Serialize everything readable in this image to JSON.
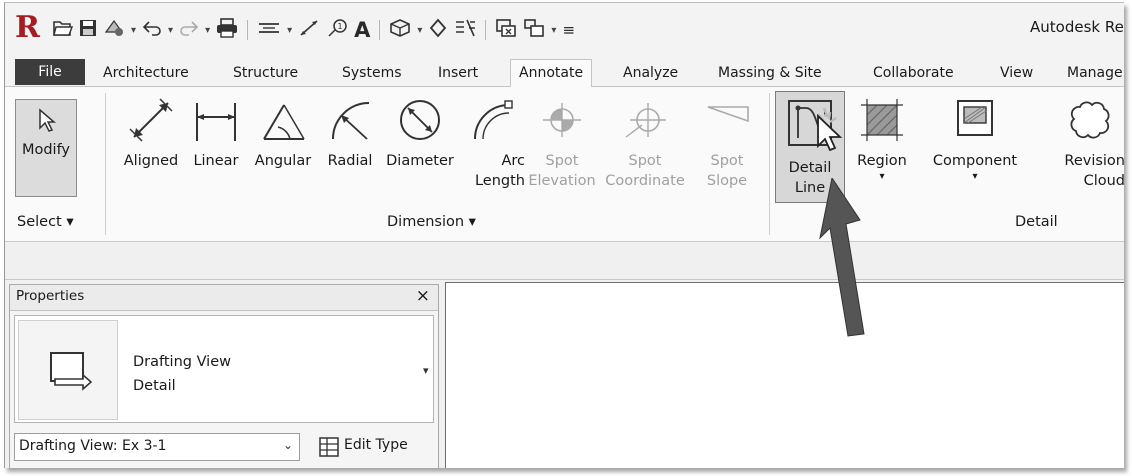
{
  "app": {
    "logo_letter": "R",
    "title": "Autodesk Re"
  },
  "quick_access": {
    "icons": [
      "open-icon",
      "save-icon",
      "sync-icon",
      "undo-icon",
      "redo-icon",
      "print-icon",
      "measure-icon",
      "dimension-icon",
      "tag-icon",
      "text-icon",
      "3d-view-icon",
      "section-icon",
      "thin-lines-icon",
      "close-hidden-icon",
      "switch-windows-icon",
      "customize-icon"
    ]
  },
  "tabs": [
    {
      "label": "File"
    },
    {
      "label": "Architecture"
    },
    {
      "label": "Structure"
    },
    {
      "label": "Systems"
    },
    {
      "label": "Insert"
    },
    {
      "label": "Annotate",
      "active": true
    },
    {
      "label": "Analyze"
    },
    {
      "label": "Massing & Site"
    },
    {
      "label": "Collaborate"
    },
    {
      "label": "View"
    },
    {
      "label": "Manage"
    }
  ],
  "ribbon": {
    "modify": {
      "label": "Modify",
      "panel": "Select ▾"
    },
    "dimension_panel": {
      "label": "Dimension ▾",
      "buttons": [
        {
          "line1": "Aligned",
          "line2": "",
          "enabled": true
        },
        {
          "line1": "Linear",
          "line2": "",
          "enabled": true
        },
        {
          "line1": "Angular",
          "line2": "",
          "enabled": true
        },
        {
          "line1": "Radial",
          "line2": "",
          "enabled": true
        },
        {
          "line1": "Diameter",
          "line2": "",
          "enabled": true
        },
        {
          "line1": "Arc",
          "line2": "Length",
          "enabled": true
        },
        {
          "line1": "Spot",
          "line2": "Elevation",
          "enabled": false
        },
        {
          "line1": "Spot",
          "line2": "Coordinate",
          "enabled": false
        },
        {
          "line1": "Spot",
          "line2": "Slope",
          "enabled": false
        }
      ]
    },
    "detail_panel": {
      "label": "Detail",
      "buttons": [
        {
          "line1": "Detail",
          "line2": "Line",
          "highlighted": true
        },
        {
          "line1": "Region",
          "line2": "▾"
        },
        {
          "line1": "Component",
          "line2": "▾"
        },
        {
          "line1": "Revision",
          "line2": "Cloud"
        }
      ]
    }
  },
  "properties": {
    "title": "Properties",
    "close": "×",
    "type_family": "Drafting View",
    "type_name": "Detail",
    "type_dropdown": "▾",
    "instance": "Drafting View: Ex 3-1",
    "instance_dropdown": "⌄",
    "edit_type": "Edit Type"
  },
  "colors": {
    "logo_red": "#a51c23",
    "file_tab": "#3c3c3c",
    "highlight_button": "#d7d7d7",
    "callout_arrow": "#555555"
  }
}
